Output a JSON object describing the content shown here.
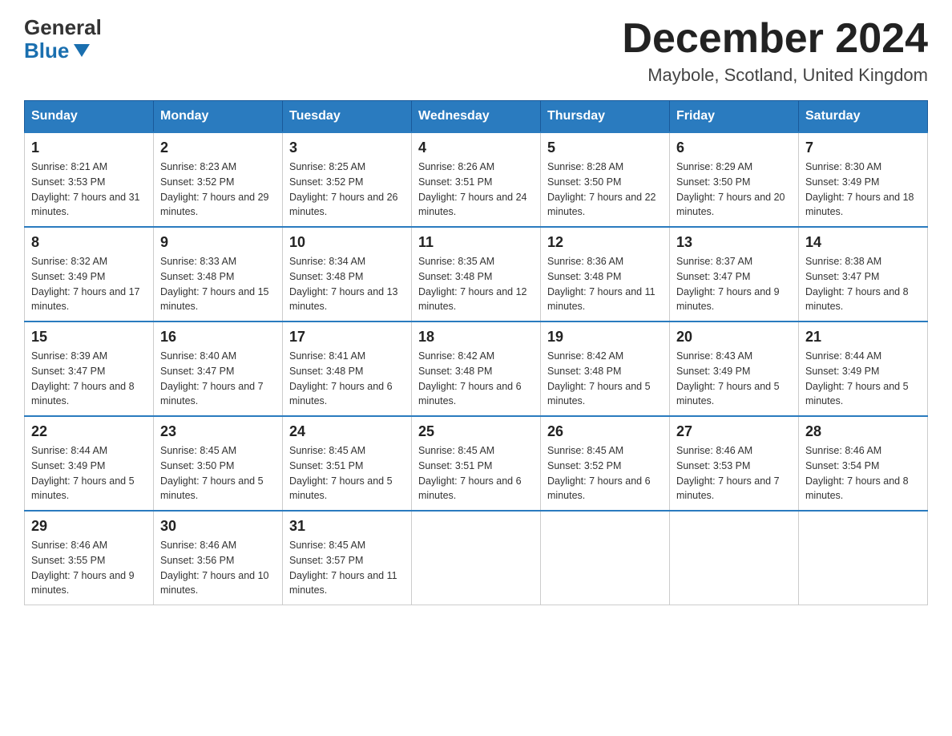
{
  "logo": {
    "general": "General",
    "blue": "Blue"
  },
  "title": "December 2024",
  "location": "Maybole, Scotland, United Kingdom",
  "days_of_week": [
    "Sunday",
    "Monday",
    "Tuesday",
    "Wednesday",
    "Thursday",
    "Friday",
    "Saturday"
  ],
  "weeks": [
    [
      {
        "day": "1",
        "sunrise": "8:21 AM",
        "sunset": "3:53 PM",
        "daylight": "7 hours and 31 minutes."
      },
      {
        "day": "2",
        "sunrise": "8:23 AM",
        "sunset": "3:52 PM",
        "daylight": "7 hours and 29 minutes."
      },
      {
        "day": "3",
        "sunrise": "8:25 AM",
        "sunset": "3:52 PM",
        "daylight": "7 hours and 26 minutes."
      },
      {
        "day": "4",
        "sunrise": "8:26 AM",
        "sunset": "3:51 PM",
        "daylight": "7 hours and 24 minutes."
      },
      {
        "day": "5",
        "sunrise": "8:28 AM",
        "sunset": "3:50 PM",
        "daylight": "7 hours and 22 minutes."
      },
      {
        "day": "6",
        "sunrise": "8:29 AM",
        "sunset": "3:50 PM",
        "daylight": "7 hours and 20 minutes."
      },
      {
        "day": "7",
        "sunrise": "8:30 AM",
        "sunset": "3:49 PM",
        "daylight": "7 hours and 18 minutes."
      }
    ],
    [
      {
        "day": "8",
        "sunrise": "8:32 AM",
        "sunset": "3:49 PM",
        "daylight": "7 hours and 17 minutes."
      },
      {
        "day": "9",
        "sunrise": "8:33 AM",
        "sunset": "3:48 PM",
        "daylight": "7 hours and 15 minutes."
      },
      {
        "day": "10",
        "sunrise": "8:34 AM",
        "sunset": "3:48 PM",
        "daylight": "7 hours and 13 minutes."
      },
      {
        "day": "11",
        "sunrise": "8:35 AM",
        "sunset": "3:48 PM",
        "daylight": "7 hours and 12 minutes."
      },
      {
        "day": "12",
        "sunrise": "8:36 AM",
        "sunset": "3:48 PM",
        "daylight": "7 hours and 11 minutes."
      },
      {
        "day": "13",
        "sunrise": "8:37 AM",
        "sunset": "3:47 PM",
        "daylight": "7 hours and 9 minutes."
      },
      {
        "day": "14",
        "sunrise": "8:38 AM",
        "sunset": "3:47 PM",
        "daylight": "7 hours and 8 minutes."
      }
    ],
    [
      {
        "day": "15",
        "sunrise": "8:39 AM",
        "sunset": "3:47 PM",
        "daylight": "7 hours and 8 minutes."
      },
      {
        "day": "16",
        "sunrise": "8:40 AM",
        "sunset": "3:47 PM",
        "daylight": "7 hours and 7 minutes."
      },
      {
        "day": "17",
        "sunrise": "8:41 AM",
        "sunset": "3:48 PM",
        "daylight": "7 hours and 6 minutes."
      },
      {
        "day": "18",
        "sunrise": "8:42 AM",
        "sunset": "3:48 PM",
        "daylight": "7 hours and 6 minutes."
      },
      {
        "day": "19",
        "sunrise": "8:42 AM",
        "sunset": "3:48 PM",
        "daylight": "7 hours and 5 minutes."
      },
      {
        "day": "20",
        "sunrise": "8:43 AM",
        "sunset": "3:49 PM",
        "daylight": "7 hours and 5 minutes."
      },
      {
        "day": "21",
        "sunrise": "8:44 AM",
        "sunset": "3:49 PM",
        "daylight": "7 hours and 5 minutes."
      }
    ],
    [
      {
        "day": "22",
        "sunrise": "8:44 AM",
        "sunset": "3:49 PM",
        "daylight": "7 hours and 5 minutes."
      },
      {
        "day": "23",
        "sunrise": "8:45 AM",
        "sunset": "3:50 PM",
        "daylight": "7 hours and 5 minutes."
      },
      {
        "day": "24",
        "sunrise": "8:45 AM",
        "sunset": "3:51 PM",
        "daylight": "7 hours and 5 minutes."
      },
      {
        "day": "25",
        "sunrise": "8:45 AM",
        "sunset": "3:51 PM",
        "daylight": "7 hours and 6 minutes."
      },
      {
        "day": "26",
        "sunrise": "8:45 AM",
        "sunset": "3:52 PM",
        "daylight": "7 hours and 6 minutes."
      },
      {
        "day": "27",
        "sunrise": "8:46 AM",
        "sunset": "3:53 PM",
        "daylight": "7 hours and 7 minutes."
      },
      {
        "day": "28",
        "sunrise": "8:46 AM",
        "sunset": "3:54 PM",
        "daylight": "7 hours and 8 minutes."
      }
    ],
    [
      {
        "day": "29",
        "sunrise": "8:46 AM",
        "sunset": "3:55 PM",
        "daylight": "7 hours and 9 minutes."
      },
      {
        "day": "30",
        "sunrise": "8:46 AM",
        "sunset": "3:56 PM",
        "daylight": "7 hours and 10 minutes."
      },
      {
        "day": "31",
        "sunrise": "8:45 AM",
        "sunset": "3:57 PM",
        "daylight": "7 hours and 11 minutes."
      },
      null,
      null,
      null,
      null
    ]
  ],
  "labels": {
    "sunrise": "Sunrise:",
    "sunset": "Sunset:",
    "daylight": "Daylight:"
  }
}
